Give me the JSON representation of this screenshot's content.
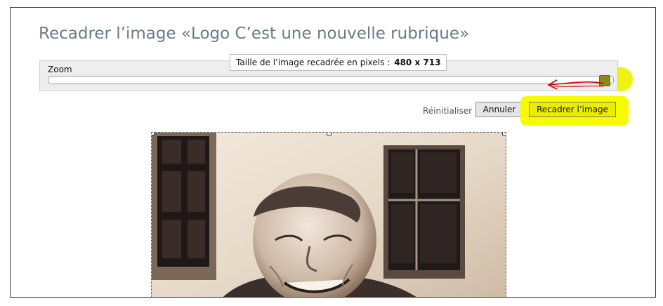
{
  "dialog": {
    "title": "Recadrer l’image «Logo C’est une nouvelle rubrique»"
  },
  "zoom": {
    "label": "Zoom",
    "level": 1.0
  },
  "tooltip": {
    "label": "Taille de l’image recadrée en pixels :",
    "value": "480 x 713"
  },
  "actions": {
    "reset_label": "Réinitialiser",
    "cancel_label": "Annuler",
    "crop_label": "Recadrer l’image"
  },
  "colors": {
    "title": "#687a88",
    "highlight": "#eef200",
    "annotation_arrow": "#cc0000"
  },
  "icons": {
    "arrow": "annotation-arrow-icon"
  }
}
